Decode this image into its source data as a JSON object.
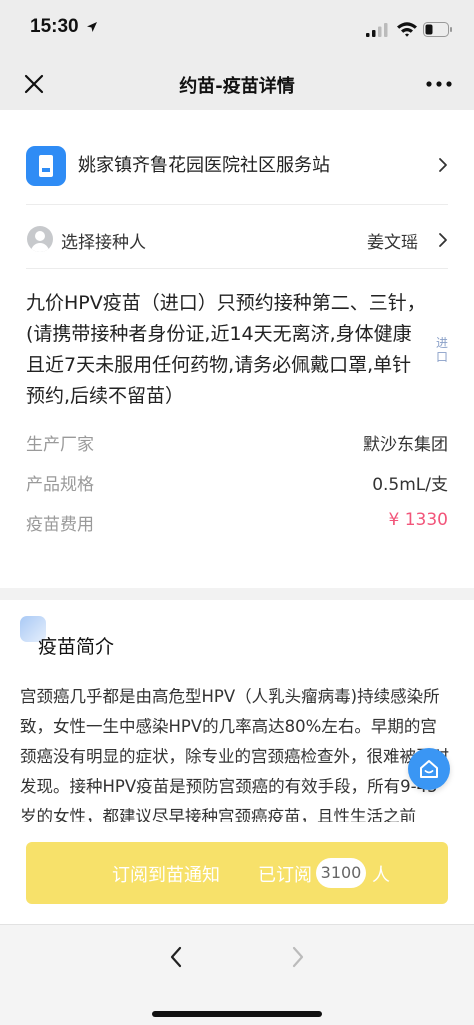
{
  "status": {
    "time": "15:30"
  },
  "nav": {
    "title": "约苗-疫苗详情"
  },
  "clinic": {
    "name": "姚家镇齐鲁花园医院社区服务站"
  },
  "recipient": {
    "label": "选择接种人",
    "name": "姜文瑶"
  },
  "vaccine": {
    "description": "九价HPV疫苗（进口）只预约接种第二、三针，(请携带接种者身份证,近14天无离济,身体健康且近7天未服用任何药物,请务必佩戴口罩,单针预约,后续不留苗）",
    "tag": "进口",
    "details": [
      {
        "label": "生产厂家",
        "value": "默沙东集团"
      },
      {
        "label": "产品规格",
        "value": "0.5mL/支"
      },
      {
        "label": "疫苗费用",
        "value": "¥ 1330"
      }
    ]
  },
  "intro": {
    "title": "疫苗简介",
    "text": "宫颈癌几乎都是由高危型HPV（人乳头瘤病毒)持续感染所致，女性一生中感染HPV的几率高达80%左右。早期的宫颈癌没有明显的症状，除专业的宫颈癌检查外，很难被及时发现。接种HPV疫苗是预防宫颈癌的有效手段，所有9-45岁的女性，都建议尽早接种宫颈癌疫苗，且性生活之前"
  },
  "subscribe": {
    "label": "订阅到苗通知",
    "subscribed_prefix": "已订阅",
    "count": "3100",
    "suffix": "人"
  },
  "colors": {
    "brand_blue": "#2f8cf5",
    "price_red": "#f2557a",
    "subscribe_yellow": "#f7e16a"
  },
  "icons": [
    "location-arrow-icon",
    "signal-icon",
    "wifi-icon",
    "battery-icon",
    "close-icon",
    "more-icon",
    "clinic-icon",
    "chevron-right-icon",
    "avatar-icon",
    "home-icon",
    "back-arrow-icon",
    "forward-arrow-icon"
  ]
}
